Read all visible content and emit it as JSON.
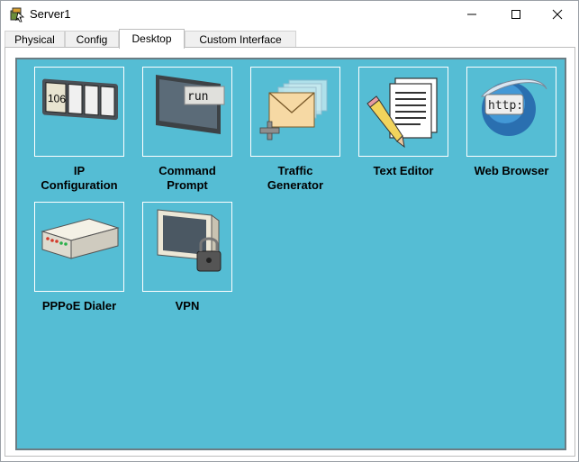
{
  "window": {
    "title": "Server1"
  },
  "tabs": [
    {
      "label": "Physical"
    },
    {
      "label": "Config"
    },
    {
      "label": "Desktop"
    },
    {
      "label": "Custom Interface"
    }
  ],
  "apps": [
    {
      "label": "IP\nConfiguration",
      "icon": "ip-configuration-icon",
      "tile_text": "106"
    },
    {
      "label": "Command\nPrompt",
      "icon": "command-prompt-icon",
      "tile_text": "run"
    },
    {
      "label": "Traffic\nGenerator",
      "icon": "traffic-generator-icon"
    },
    {
      "label": "Text Editor",
      "icon": "text-editor-icon"
    },
    {
      "label": "Web Browser",
      "icon": "web-browser-icon",
      "tile_text": "http:"
    },
    {
      "label": "PPPoE Dialer",
      "icon": "pppoe-dialer-icon"
    },
    {
      "label": "VPN",
      "icon": "vpn-icon"
    }
  ],
  "colors": {
    "desktop_bg": "#55bdd4",
    "desktop_border": "#6a7d84"
  }
}
